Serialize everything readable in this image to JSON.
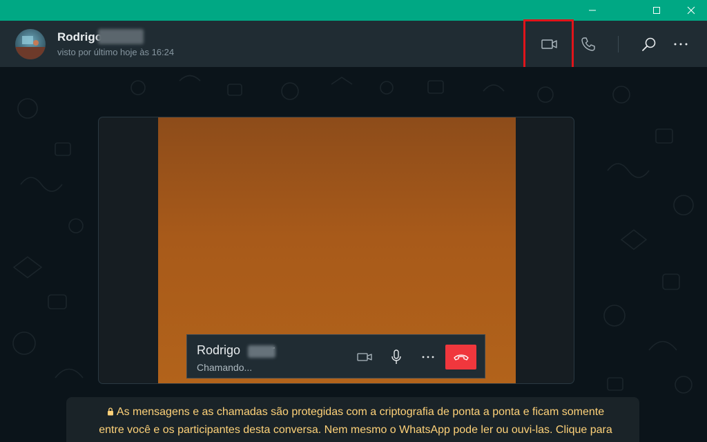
{
  "window_controls": {
    "minimize_icon": "minimize-icon",
    "maximize_icon": "maximize-icon",
    "close_icon": "close-icon"
  },
  "header": {
    "contact_name": "Rodrigo",
    "last_seen": "visto por último hoje às 16:24",
    "actions": [
      "video-call-icon",
      "voice-call-icon",
      "search-icon",
      "more-icon"
    ],
    "highlight_color": "#e0141a"
  },
  "call": {
    "contact_name": "Rodrigo",
    "name_trailing": "r",
    "status": "Chamando...",
    "controls": [
      "camera-icon",
      "microphone-icon",
      "more-icon",
      "hang-up-icon"
    ],
    "hangup_color": "#f0373d"
  },
  "notice": {
    "line1": "As mensagens e as chamadas são protegidas com a criptografia de ponta a ponta e ficam somente",
    "line2": "entre você e os participantes desta conversa. Nem mesmo o WhatsApp pode ler ou ouvi-las. Clique para"
  },
  "colors": {
    "titlebar": "#00a884",
    "header_bg": "#202c33",
    "chat_bg": "#0b141a",
    "notice_text": "#ffd279"
  }
}
